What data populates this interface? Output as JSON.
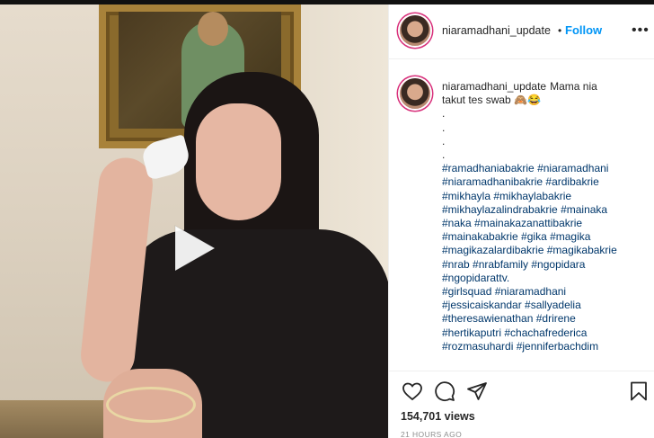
{
  "post": {
    "username": "niaramadhani_update",
    "follow_label": "Follow",
    "separator": "•",
    "more_label": "•••",
    "caption": {
      "username": "niaramadhani_update",
      "lines": [
        "Mama nia",
        "takut tes swab 🙈😂",
        ".",
        ".",
        ".",
        ".",
        "#ramadhaniabakrie #niaramadhani",
        "#niaramadhanibakrie #ardibakrie",
        "#mikhayla #mikhaylabakrie",
        "#mikhaylazalindrabakrie #mainaka",
        "#naka #mainakazanattibakrie",
        "#mainakabakrie #gika #magika",
        "#magikazalardibakrie #magikabakrie",
        "#nrab #nrabfamily #ngopidara",
        "#ngopidarattv.",
        "#girlsquad #niaramadhani",
        "#jessicaiskandar #sallyadelia",
        "#theresawienathan #drirene",
        "#hertikaputri #chachafrederica",
        "#rozmasuhardi #jenniferbachdim"
      ]
    },
    "views": "154,701 views",
    "time_ago": "21 HOURS AGO"
  },
  "icons": {
    "like": "heart-icon",
    "comment": "comment-icon",
    "share": "share-icon",
    "save": "bookmark-icon",
    "play": "play-icon"
  },
  "colors": {
    "accent": "#0095f6",
    "hashtag": "#00376b",
    "muted": "#8e8e8e"
  }
}
